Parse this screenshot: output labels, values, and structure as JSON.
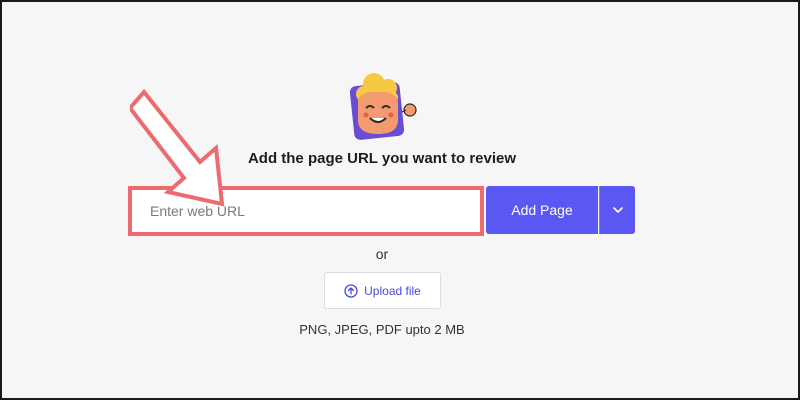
{
  "main": {
    "headline": "Add the page URL you want to review",
    "url_input": {
      "placeholder": "Enter web URL",
      "value": ""
    },
    "add_page_label": "Add Page",
    "or_label": "or",
    "upload_label": "Upload file",
    "formats_note": "PNG, JPEG, PDF upto 2 MB"
  },
  "colors": {
    "accent": "#5b57f2",
    "highlight": "#ec6b6f",
    "background": "#f6f6f6"
  },
  "icons": {
    "mascot": "mascot-illustration",
    "dropdown": "chevron-down-icon",
    "upload": "upload-icon",
    "annotation": "arrow-annotation"
  }
}
